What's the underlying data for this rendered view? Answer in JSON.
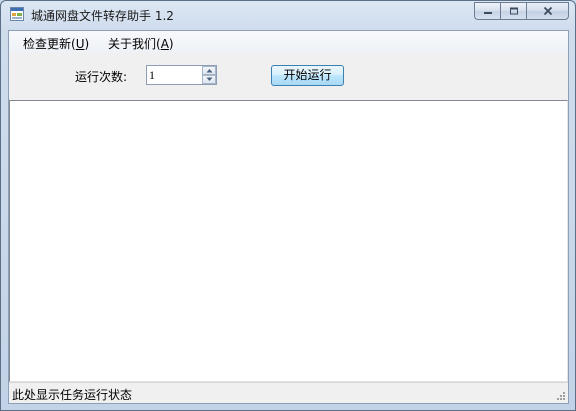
{
  "window": {
    "title": "城通网盘文件转存助手 1.2",
    "icons": {
      "app": "app-icon",
      "minimize": "minimize-icon",
      "maximize": "maximize-icon",
      "close": "close-icon"
    }
  },
  "menu": {
    "items": [
      {
        "label_main": "检查更新(",
        "accel": "U",
        "label_end": ")"
      },
      {
        "label_main": "关于我们(",
        "accel": "A",
        "label_end": ")"
      }
    ]
  },
  "toolbar": {
    "run_count_label": "运行次数:",
    "run_count_value": "1",
    "start_button_label": "开始运行"
  },
  "log": {
    "content": ""
  },
  "status": {
    "text": "此处显示任务运行状态"
  },
  "colors": {
    "accent_button_border": "#3c7fb1",
    "window_frame": "#c3d3e7",
    "client_bg": "#f0f0f0"
  }
}
